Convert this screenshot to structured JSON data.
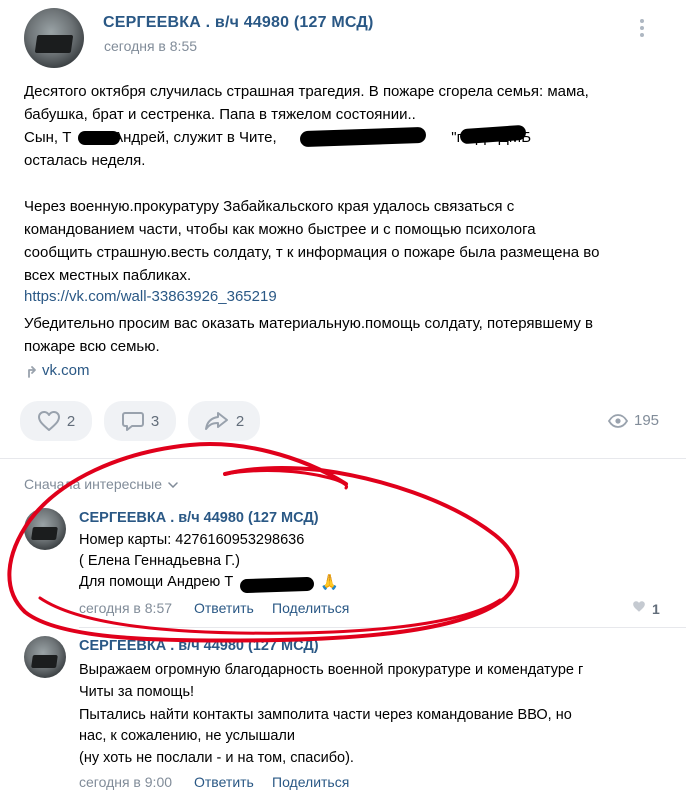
{
  "post": {
    "author": "СЕРГЕЕВКА . в/ч 44980 (127 МСД)",
    "time": "сегодня в 8:55",
    "menu_icon": "more-vertical-icon",
    "lines": [
      "Десятого октября случилась страшная трагедия. В пожаре сгорела семья: мама,",
      "бабушка, брат и сестренка. Папа в тяжелом состоянии..",
      "Сын, Т          Андрей, служит в Чите,                        в/               \"г\". До ДМБ",
      "осталась неделя.",
      "Через военную.прокуратуру Забайкальского края удалось связаться с",
      "командованием части, чтобы как можно быстрее и с помощью психолога",
      "сообщить страшную.весть солдату, т к информация о пожаре была размещена во",
      "всех местных пабликах.",
      "Убедительно просим вас оказать материальную.помощь солдату, потерявшему в",
      "пожаре всю семью."
    ],
    "wall_link": "https://vk.com/wall-33863926_365219",
    "attachment_link": "vk.com",
    "likes": "2",
    "comments": "3",
    "shares": "2",
    "views": "195"
  },
  "comments": {
    "sort_label": "Сначала интересные",
    "items": [
      {
        "author": "СЕРГЕЕВКА . в/ч 44980 (127 МСД)",
        "lines": [
          "Номер карты: 4276160953298636",
          "( Елена Геннадьевна Г.)",
          "Для помощи Андрею Т"
        ],
        "emoji": "🙏",
        "time": "сегодня в 8:57",
        "reply": "Ответить",
        "share": "Поделиться",
        "likes": "1"
      },
      {
        "author": "СЕРГЕЕВКА . в/ч 44980 (127 МСД)",
        "lines": [
          "Выражаем огромную благодарность военной прокуратуре и комендатуре г",
          "Читы за помощь!",
          "Пытались найти контакты замполита части через командование ВВО, но",
          "нас, к сожалению, не услышали",
          "(ну хоть не послали - и на том, спасибо)."
        ],
        "time": "сегодня в 9:00",
        "reply": "Ответить",
        "share": "Поделиться"
      }
    ]
  },
  "colors": {
    "link": "#2a5885",
    "muted": "#818c99",
    "pill_bg": "#f0f2f5",
    "annotation_red": "#e0001b"
  }
}
